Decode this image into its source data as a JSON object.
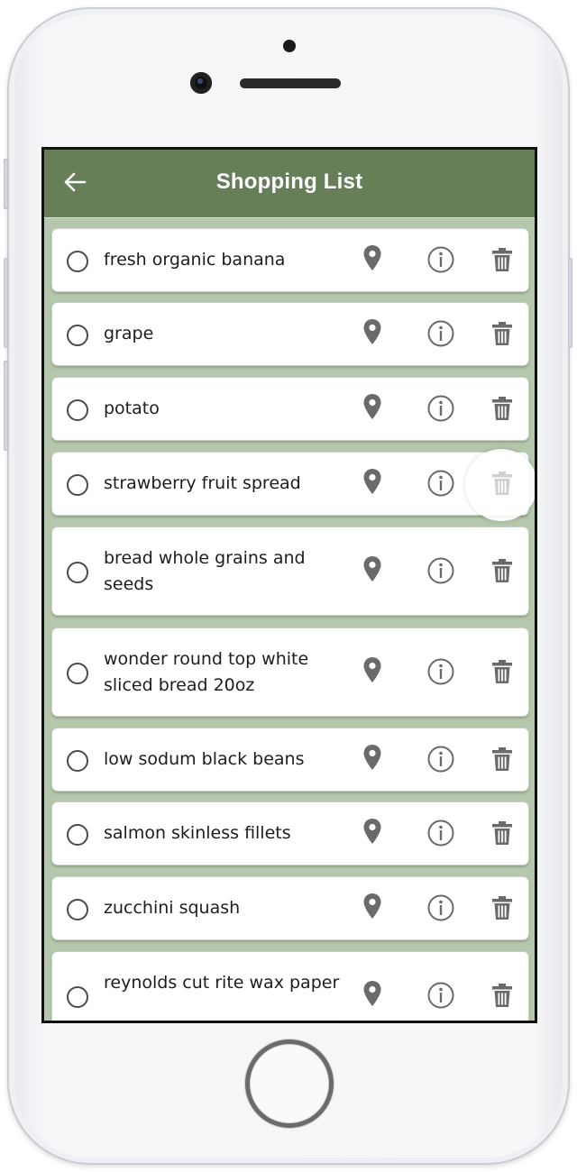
{
  "header": {
    "title": "Shopping List",
    "back_icon": "arrow-left-icon"
  },
  "colors": {
    "header_bg": "#667f58",
    "list_bg": "#b5c7ad",
    "icon": "#6a6a6a"
  },
  "icons": {
    "location": "map-pin-icon",
    "info": "info-circle-icon",
    "delete": "trash-icon"
  },
  "items": [
    {
      "label": "fresh organic banana",
      "checked": false
    },
    {
      "label": "grape",
      "checked": false
    },
    {
      "label": "potato",
      "checked": false
    },
    {
      "label": "strawberry fruit spread",
      "checked": false
    },
    {
      "label": "bread whole grains and seeds",
      "checked": false
    },
    {
      "label": "wonder round top white sliced bread 20oz",
      "checked": false
    },
    {
      "label": "low sodum black beans",
      "checked": false
    },
    {
      "label": "salmon skinless fillets",
      "checked": false
    },
    {
      "label": "zucchini squash",
      "checked": false
    },
    {
      "label": "reynolds cut rite wax paper",
      "checked": false
    }
  ]
}
